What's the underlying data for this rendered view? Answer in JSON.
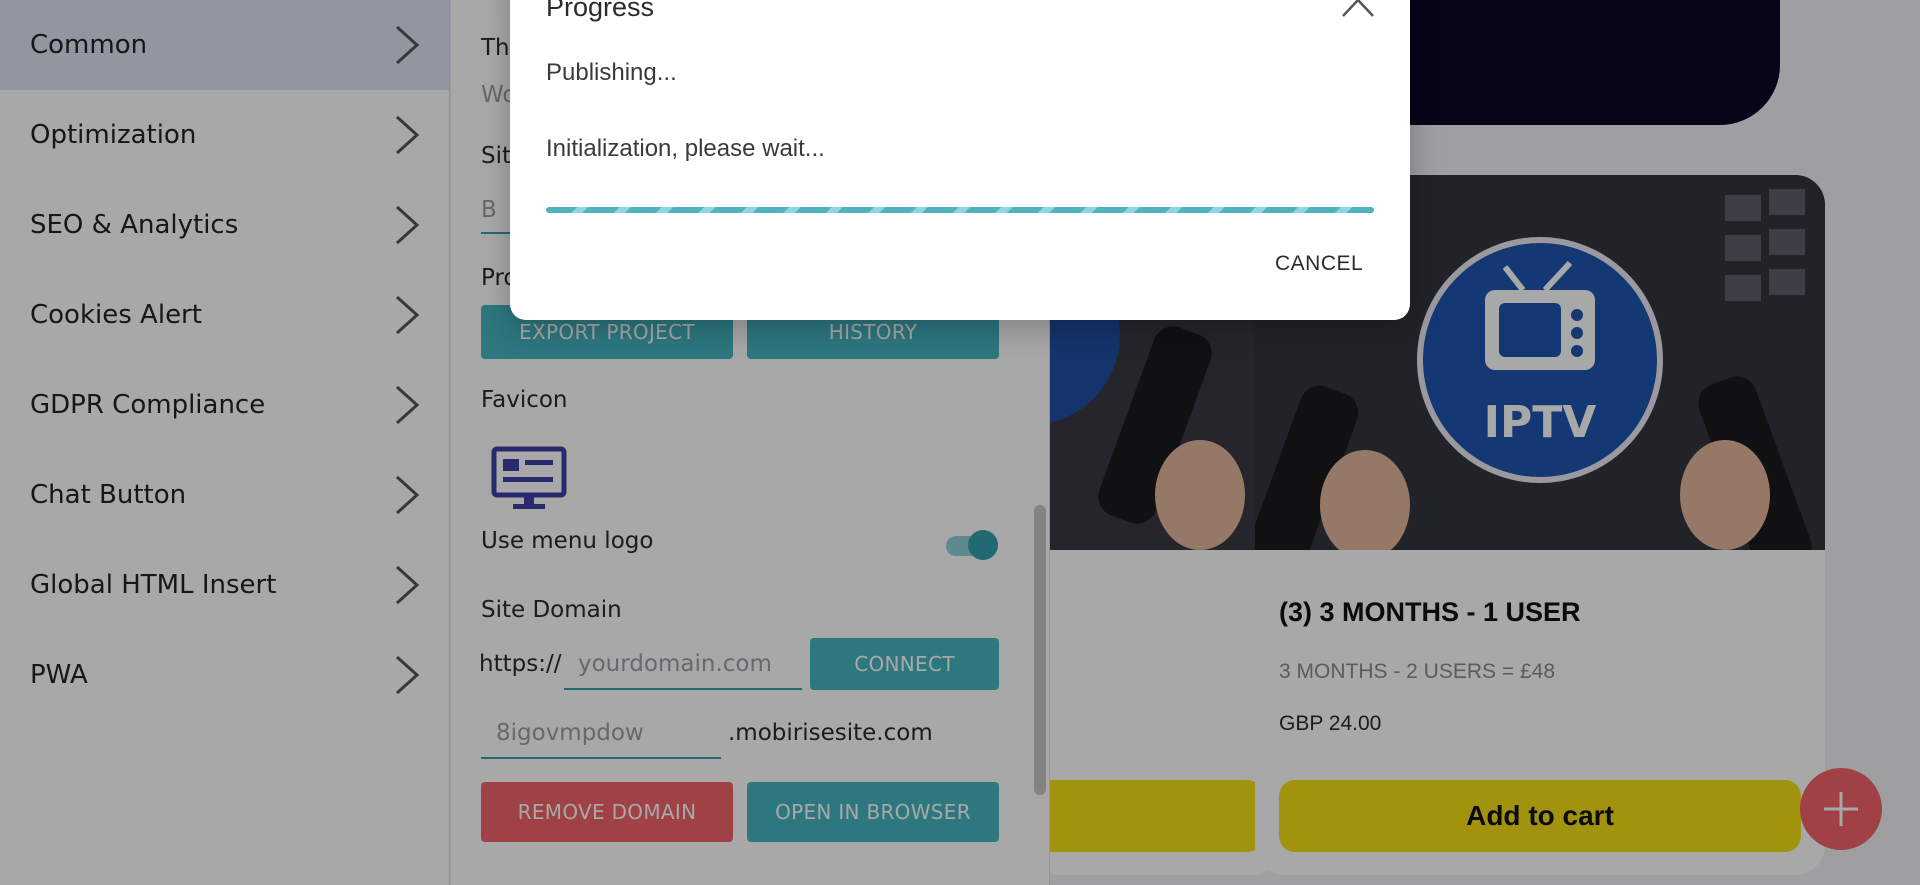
{
  "sidebar": {
    "items": [
      {
        "label": "Common"
      },
      {
        "label": "Optimization"
      },
      {
        "label": "SEO & Analytics"
      },
      {
        "label": "Cookies Alert"
      },
      {
        "label": "GDPR Compliance"
      },
      {
        "label": "Chat Button"
      },
      {
        "label": "Global HTML Insert"
      },
      {
        "label": "PWA"
      }
    ]
  },
  "panel": {
    "truncated_labels": {
      "theme": "The",
      "theme_value": "Wo",
      "site": "Site",
      "site_value": "B",
      "project": "Pro"
    },
    "export_project_label": "EXPORT PROJECT",
    "history_label": "HISTORY",
    "favicon_label": "Favicon",
    "use_menu_logo_label": "Use menu logo",
    "use_menu_logo_on": true,
    "site_domain_label": "Site Domain",
    "domain_prefix": "https://",
    "domain_placeholder": "yourdomain.com",
    "connect_label": "CONNECT",
    "subdomain_value": "8igovmpdow",
    "subdomain_suffix": ".mobirisesite.com",
    "remove_domain_label": "REMOVE DOMAIN",
    "open_in_browser_label": "OPEN IN BROWSER"
  },
  "preview": {
    "product_title": "(3) 3 MONTHS - 1 USER",
    "product_subtitle": "3 MONTHS - 2 USERS = £48",
    "product_price": "GBP 24.00",
    "add_to_cart_label": "Add to cart",
    "iptv_badge": "IPTV"
  },
  "dialog": {
    "title": "Progress",
    "status": "Publishing...",
    "message": "Initialization, please wait...",
    "cancel_label": "CANCEL"
  },
  "colors": {
    "accent_teal": "#45b5c1",
    "danger_red": "#f2636a",
    "cart_yellow": "#f6e016",
    "sidebar_active": "#dce4f5"
  },
  "icons": [
    "chevron-right-icon",
    "favicon-monitor-icon",
    "close-chevron-icon",
    "plus-icon",
    "tv-icon"
  ]
}
